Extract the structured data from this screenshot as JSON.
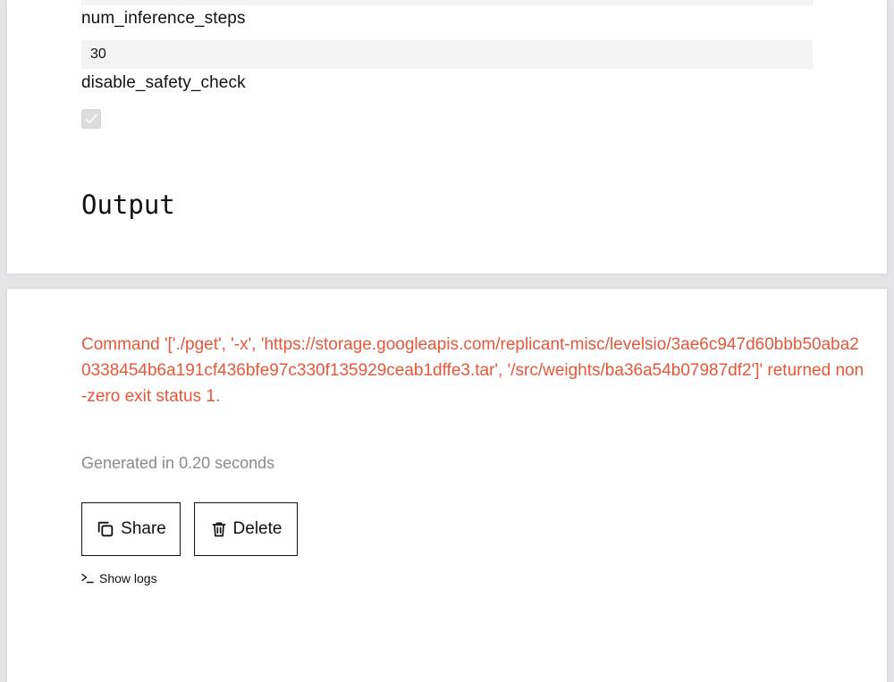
{
  "inputs": {
    "num_inference_steps": {
      "label": "num_inference_steps",
      "value": "30"
    },
    "disable_safety_check": {
      "label": "disable_safety_check",
      "checked": true
    }
  },
  "output": {
    "heading": "Output",
    "error_message": "Command '['./pget', '-x', 'https://storage.googleapis.com/replicant-misc/levelsio/3ae6c947d60bbb50aba20338454b6a191cf436bfe97c330f135929ceab1dffe3.tar', '/src/weights/ba36a54b07987df2']' returned non-zero exit status 1.",
    "generated_time": "Generated in 0.20 seconds",
    "actions": {
      "share_label": "Share",
      "delete_label": "Delete",
      "show_logs_label": "Show logs"
    }
  },
  "icons": {
    "share": "copy-icon",
    "delete": "trash-icon",
    "logs": "terminal-icon",
    "checkbox": "check-icon"
  },
  "colors": {
    "error": "#e8563a",
    "muted": "#8a8a8a",
    "input_bg": "#f3f3f3",
    "page_bg": "#e4e4e7"
  }
}
